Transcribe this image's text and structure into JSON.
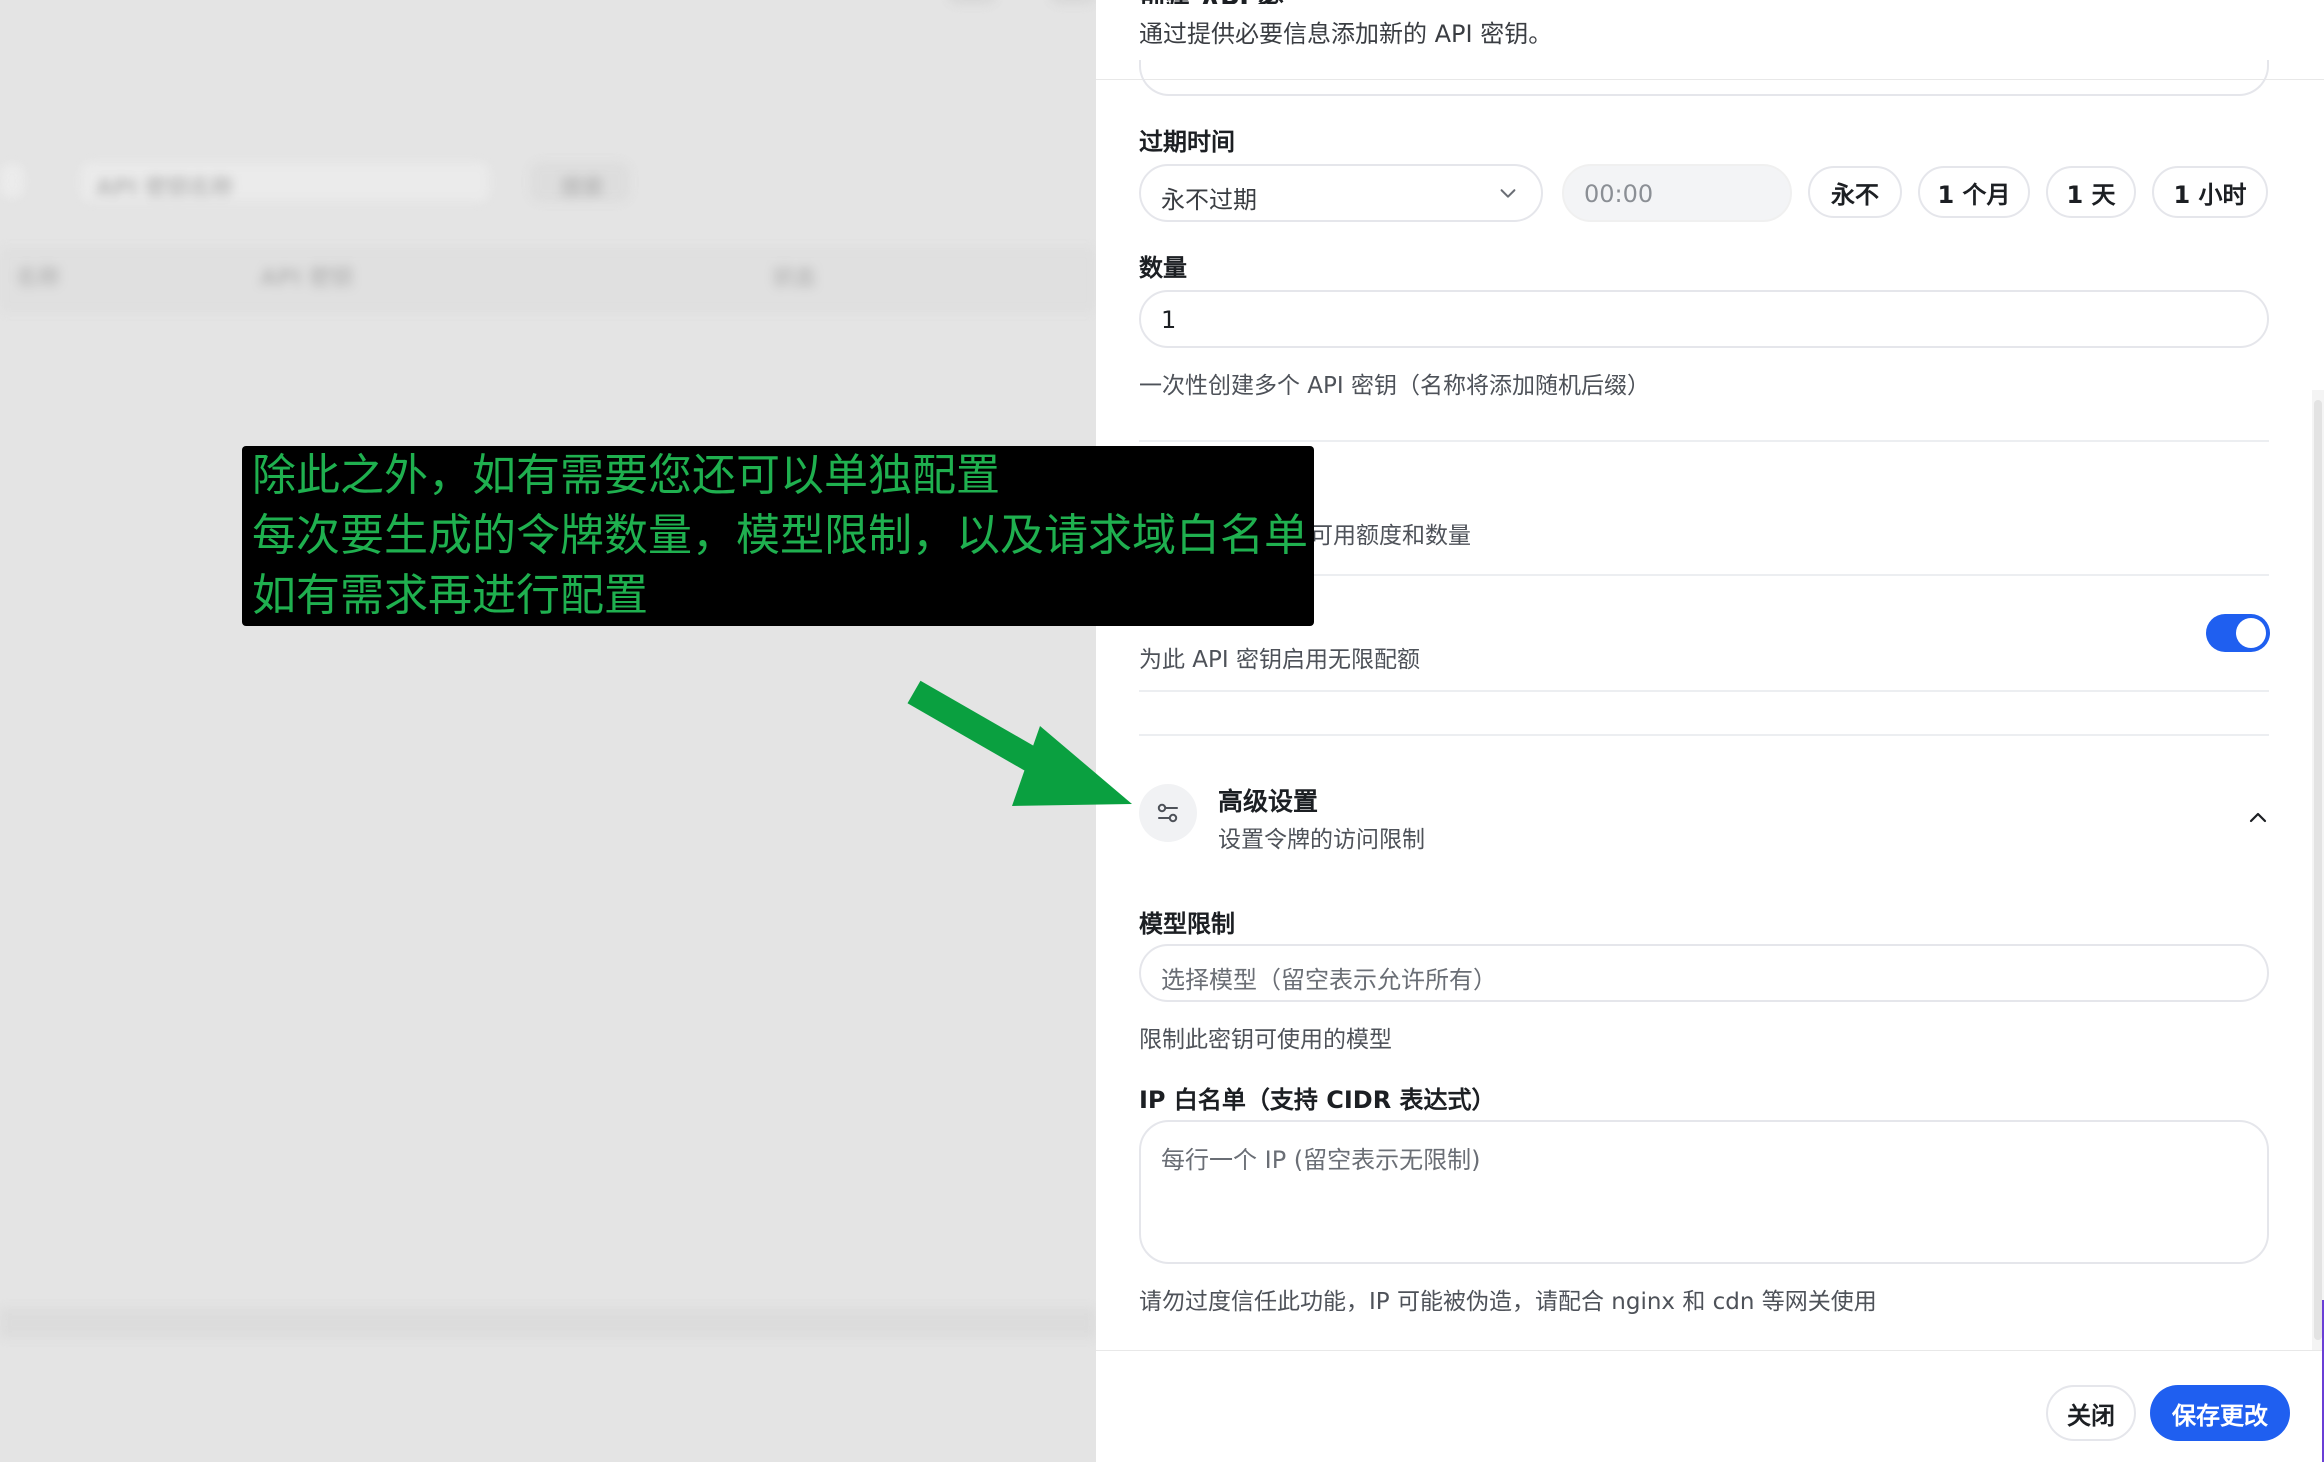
{
  "background": {
    "search_placeholder": "API 密钥名称",
    "search_button": "搜索",
    "col_name": "名称",
    "col_key": "API 密钥",
    "col_status": "状态"
  },
  "panel": {
    "subtitle": "通过提供必要信息添加新的 API 密钥。",
    "expire": {
      "label": "过期时间",
      "select_value": "永不过期",
      "time_placeholder": "00:00",
      "quick_options": [
        "永不",
        "1 个月",
        "1 天",
        "1 小时"
      ]
    },
    "quantity": {
      "label": "数量",
      "value": "1",
      "help": "一次性创建多个 API 密钥（名称将添加随机后缀）"
    },
    "quota": {
      "help_fragment": "可用额度和数量"
    },
    "unlimited": {
      "help": "为此 API 密钥启用无限配额",
      "enabled": true
    },
    "advanced": {
      "title": "高级设置",
      "subtitle": "设置令牌的访问限制",
      "icon": "sliders-icon",
      "expanded": true
    },
    "model_limit": {
      "label": "模型限制",
      "placeholder": "选择模型（留空表示允许所有）",
      "help": "限制此密钥可使用的模型"
    },
    "ip_whitelist": {
      "label": "IP 白名单（支持 CIDR 表达式）",
      "placeholder": "每行一个 IP (留空表示无限制)",
      "help": "请勿过度信任此功能，IP 可能被伪造，请配合 nginx 和 cdn 等网关使用"
    },
    "footer": {
      "close_label": "关闭",
      "save_label": "保存更改"
    }
  },
  "annotation": {
    "lines": [
      "除此之外，如有需要您还可以单独配置",
      "每次要生成的令牌数量，模型限制，以及请求域白名单",
      "如有需求再进行配置"
    ],
    "text_color": "#1fb04f",
    "arrow_color": "#0aa040"
  },
  "colors": {
    "primary": "#1f5ff0",
    "panel_bg": "#ffffff",
    "overlay_bg": "#e4e4e4"
  }
}
